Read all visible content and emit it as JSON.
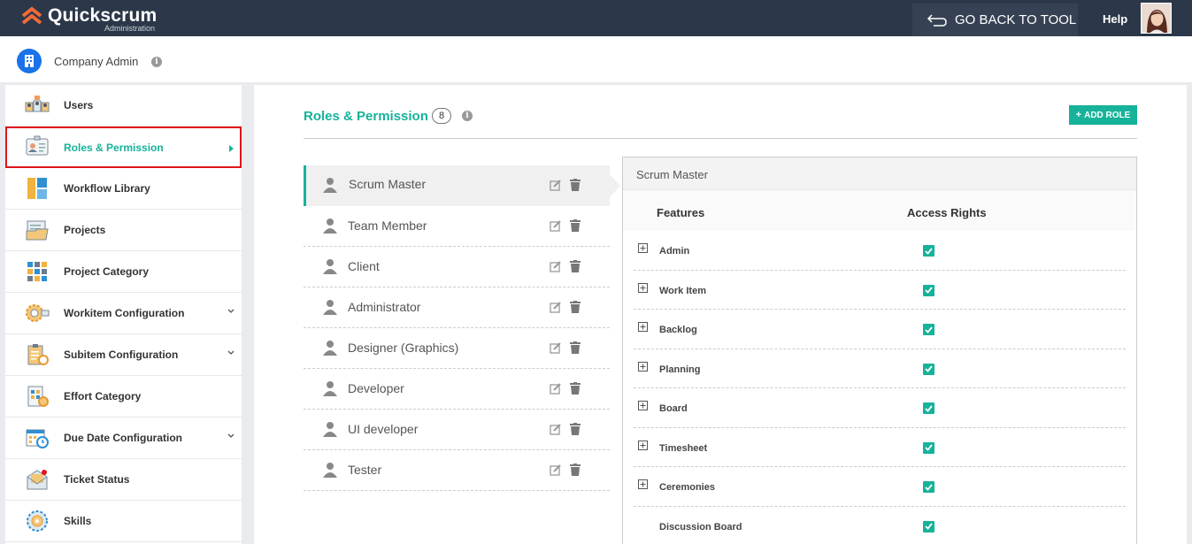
{
  "app": {
    "name": "Quickscrum",
    "subtitle": "Administration"
  },
  "topbar": {
    "back_label": "GO BACK TO TOOL",
    "help_label": "Help"
  },
  "subheader": {
    "title": "Company Admin"
  },
  "sidebar": {
    "items": [
      {
        "label": "Users",
        "icon": "users-icon"
      },
      {
        "label": "Roles & Permission",
        "icon": "id-card-icon",
        "active": true
      },
      {
        "label": "Workflow Library",
        "icon": "workflow-icon"
      },
      {
        "label": "Projects",
        "icon": "folder-icon"
      },
      {
        "label": "Project Category",
        "icon": "grid-icon"
      },
      {
        "label": "Workitem Configuration",
        "icon": "gear-cog-icon",
        "expandable": true
      },
      {
        "label": "Subitem Configuration",
        "icon": "clipboard-gear-icon",
        "expandable": true
      },
      {
        "label": "Effort Category",
        "icon": "effort-icon"
      },
      {
        "label": "Due Date Configuration",
        "icon": "calendar-clock-icon",
        "expandable": true
      },
      {
        "label": "Ticket Status",
        "icon": "ticket-envelope-icon"
      },
      {
        "label": "Skills",
        "icon": "skills-gear-icon"
      }
    ]
  },
  "main": {
    "title": "Roles & Permission",
    "count": "8",
    "add_role_label": "ADD ROLE",
    "roles": [
      {
        "name": "Scrum Master",
        "active": true
      },
      {
        "name": "Team Member"
      },
      {
        "name": "Client"
      },
      {
        "name": "Administrator"
      },
      {
        "name": "Designer (Graphics)"
      },
      {
        "name": "Developer"
      },
      {
        "name": "UI developer"
      },
      {
        "name": "Tester"
      }
    ],
    "permissions": {
      "role_title": "Scrum Master",
      "col_features": "Features",
      "col_access": "Access Rights",
      "features": [
        {
          "name": "Admin",
          "checked": true,
          "expandable": true
        },
        {
          "name": "Work Item",
          "checked": true,
          "expandable": true
        },
        {
          "name": "Backlog",
          "checked": true,
          "expandable": true
        },
        {
          "name": "Planning",
          "checked": true,
          "expandable": true
        },
        {
          "name": "Board",
          "checked": true,
          "expandable": true
        },
        {
          "name": "Timesheet",
          "checked": true,
          "expandable": true
        },
        {
          "name": "Ceremonies",
          "checked": true,
          "expandable": true
        },
        {
          "name": "Discussion Board",
          "checked": true,
          "expandable": false
        }
      ]
    }
  },
  "colors": {
    "accent": "#16b29a",
    "topbar": "#2c3849",
    "active_border": "#e0141b"
  }
}
